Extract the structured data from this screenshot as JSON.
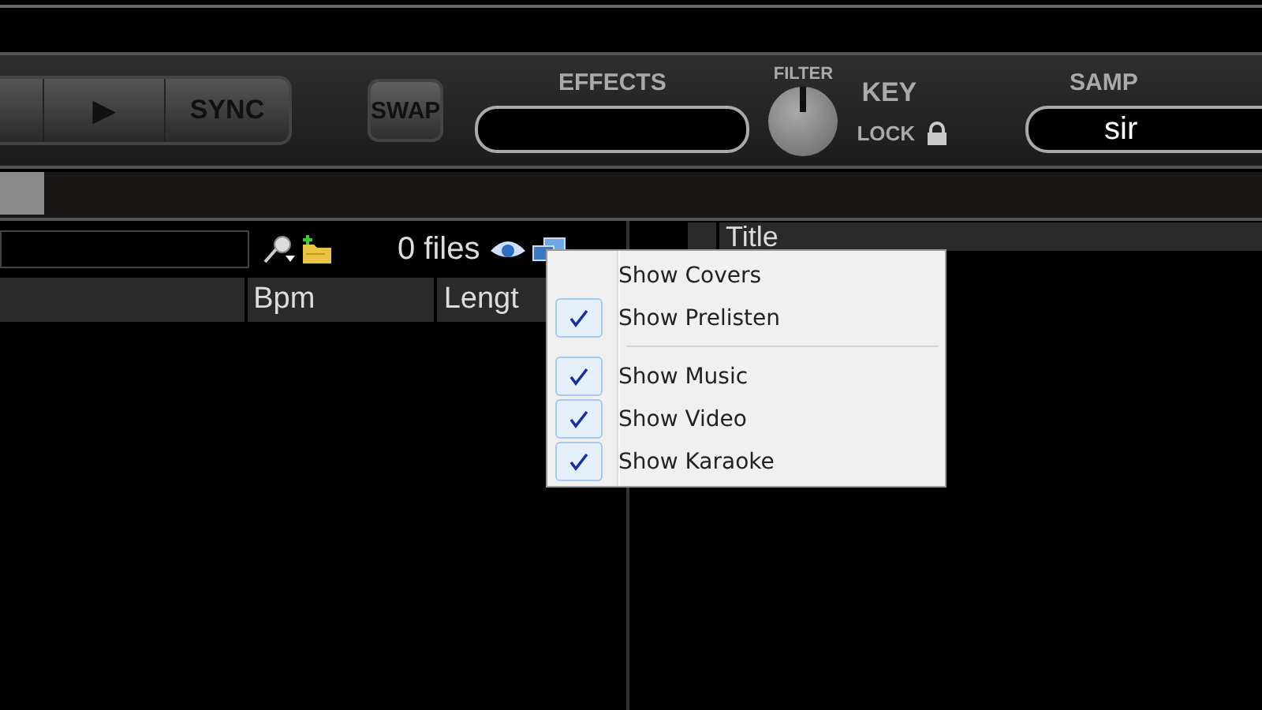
{
  "toolbar": {
    "play": "▶",
    "sync": "SYNC",
    "swap": "SWAP",
    "effects": {
      "label": "EFFECTS"
    },
    "filter": {
      "label": "FILTER"
    },
    "key": "KEY",
    "lock": "LOCK",
    "sampler": {
      "label": "SAMP",
      "value": "sir"
    }
  },
  "browser": {
    "file_count": "0 files",
    "columns": [
      {},
      {
        "label": "Bpm"
      },
      {
        "label": "Lengt"
      }
    ],
    "right_columns": [
      {
        "label": "Title"
      }
    ]
  },
  "menu": [
    {
      "label": "Show Covers",
      "checked": false,
      "kind": "item"
    },
    {
      "label": "Show Prelisten",
      "checked": true,
      "kind": "item"
    },
    {
      "kind": "separator"
    },
    {
      "label": "Show Music",
      "checked": true,
      "kind": "item"
    },
    {
      "label": "Show Video",
      "checked": true,
      "kind": "item"
    },
    {
      "label": "Show Karaoke",
      "checked": true,
      "kind": "item"
    }
  ]
}
